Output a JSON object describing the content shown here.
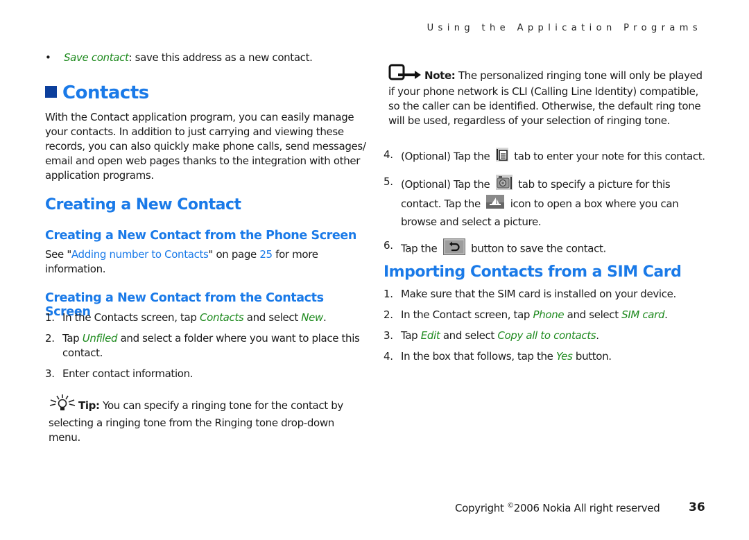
{
  "header": {
    "running_title": "Using the Application Programs"
  },
  "left": {
    "bullet": {
      "term": "Save contact",
      "rest": ": save this address as a new contact."
    },
    "section_title": "Contacts",
    "intro": "With the Contact application program, you can easily manage your contacts. In addition to just carrying and viewing these records, you can also quickly make phone calls, send messages/ email and open web pages thanks to the integration with other application programs.",
    "h2_creating": "Creating a New Contact",
    "h3_phone": "Creating a New Contact from the Phone Screen",
    "phone_text": {
      "pre": "See \"",
      "link": "Adding number to Contacts",
      "mid": "\" on page ",
      "page": "25",
      "post": " for more information."
    },
    "h3_contacts": "Creating a New Contact from the Contacts Screen",
    "steps": [
      {
        "num": "1.",
        "parts": [
          {
            "t": "In the Contacts screen, tap "
          },
          {
            "g": "Contacts"
          },
          {
            "t": " and select "
          },
          {
            "g": "New"
          },
          {
            "t": "."
          }
        ]
      },
      {
        "num": "2.",
        "parts": [
          {
            "t": "Tap "
          },
          {
            "g": "Unfiled"
          },
          {
            "t": " and select a folder where you want to place this contact."
          }
        ]
      },
      {
        "num": "3.",
        "parts": [
          {
            "t": "Enter contact information."
          }
        ]
      }
    ],
    "tip": {
      "label": "Tip:",
      "text": " You can specify a ringing tone for the contact by selecting a ringing tone from the Ringing tone drop-down menu."
    }
  },
  "right": {
    "note": {
      "label": "Note:",
      "text": " The personalized ringing tone will only be played if your phone network is CLI (Calling Line Identity) compatible, so the caller can be identified. Otherwise, the default ring tone will be used, regardless of your selection of ringing tone."
    },
    "step4": {
      "num": "4.",
      "pre": "(Optional) Tap the",
      "post": "tab to enter your note for this contact."
    },
    "step5": {
      "num": "5.",
      "pre": "(Optional) Tap the",
      "mid": "tab to specify a picture for this contact. Tap the",
      "post": "icon to open a box where you can browse and select a picture."
    },
    "step6": {
      "num": "6.",
      "pre": "Tap the",
      "post": "button to save the contact."
    },
    "h2_import": "Importing Contacts from a SIM Card",
    "import_steps": [
      {
        "num": "1.",
        "parts": [
          {
            "t": "Make sure that the SIM card is installed on your device."
          }
        ]
      },
      {
        "num": "2.",
        "parts": [
          {
            "t": "In the Contact screen, tap "
          },
          {
            "g": "Phone"
          },
          {
            "t": " and select "
          },
          {
            "g": "SIM card"
          },
          {
            "t": "."
          }
        ]
      },
      {
        "num": "3.",
        "parts": [
          {
            "t": "Tap "
          },
          {
            "g": "Edit"
          },
          {
            "t": " and select "
          },
          {
            "g": "Copy all to contacts"
          },
          {
            "t": "."
          }
        ]
      },
      {
        "num": "4.",
        "parts": [
          {
            "t": "In the box that follows, tap the "
          },
          {
            "g": "Yes"
          },
          {
            "t": " button."
          }
        ]
      }
    ]
  },
  "footer": {
    "copyright_pre": "Copyright ",
    "copyright_sym": "©",
    "copyright_post": "2006 Nokia All right reserved",
    "page_number": "36"
  },
  "colors": {
    "heading": "#1a7ae8",
    "menu_term": "#1e8a1e",
    "section_square": "#0c3f9c",
    "text": "#1a1a1a"
  }
}
